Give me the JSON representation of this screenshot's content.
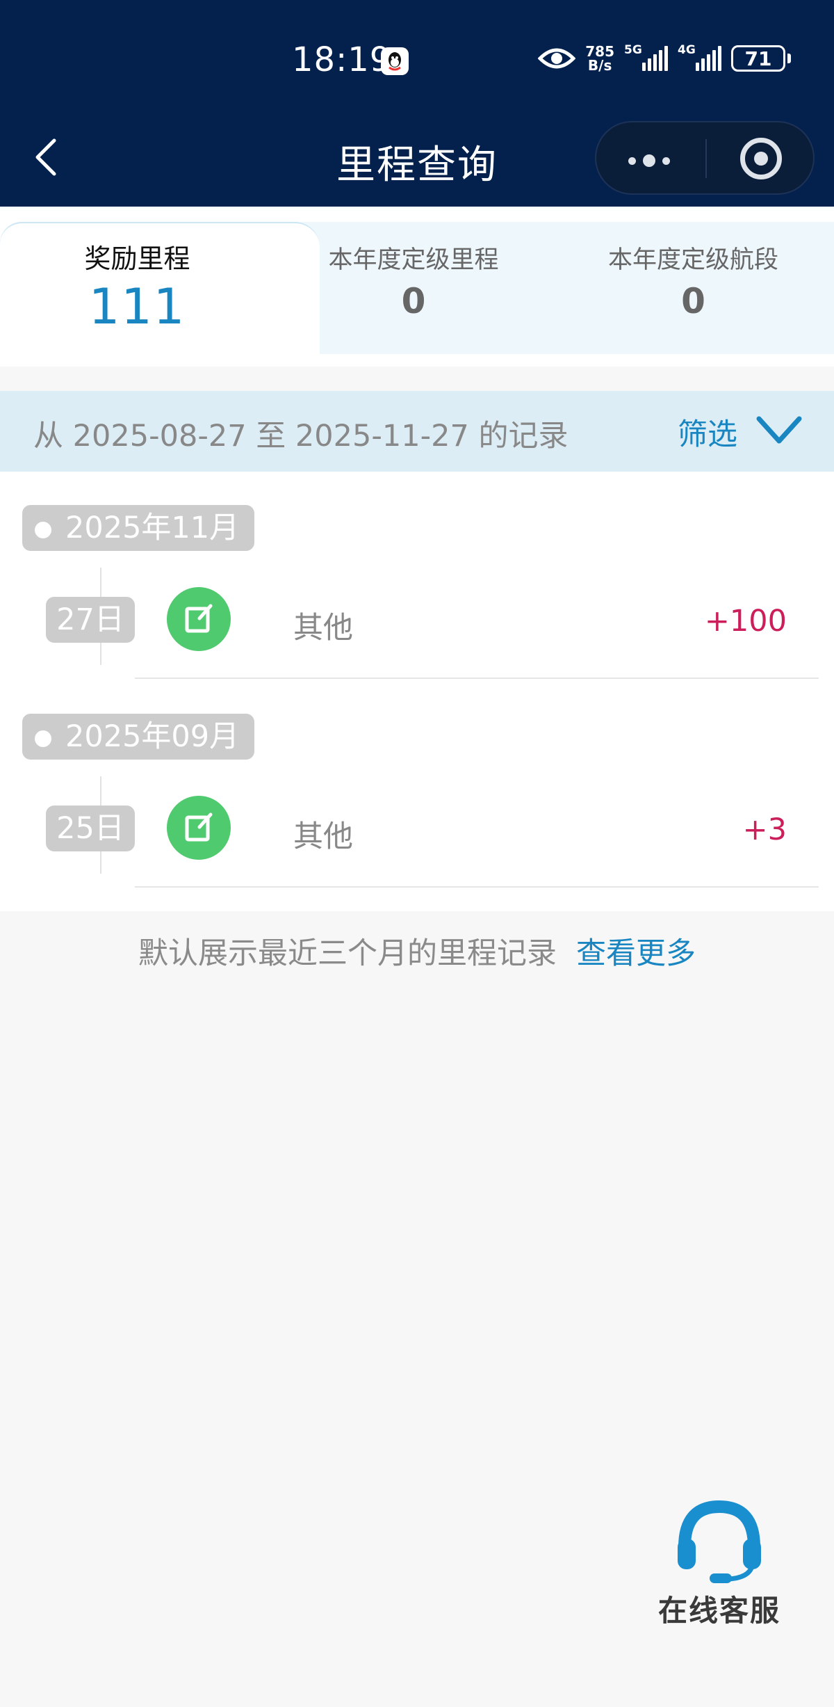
{
  "status_bar": {
    "time": "18:19",
    "net_speed_top": "785",
    "net_speed_bottom": "B/s",
    "sim1": "5G",
    "sim2": "4G",
    "battery": "71"
  },
  "nav": {
    "title": "里程查询"
  },
  "tabs": [
    {
      "label": "奖励里程",
      "value": "111",
      "active": true
    },
    {
      "label": "本年度定级里程",
      "value": "0",
      "active": false
    },
    {
      "label": "本年度定级航段",
      "value": "0",
      "active": false
    }
  ],
  "filter": {
    "range_text": "从 2025-08-27 至 2025-11-27 的记录",
    "button_label": "筛选"
  },
  "records": [
    {
      "month": "2025年11月",
      "day": "27日",
      "name": "其他",
      "amount": "+100"
    },
    {
      "month": "2025年09月",
      "day": "25日",
      "name": "其他",
      "amount": "+3"
    }
  ],
  "footer": {
    "note": "默认展示最近三个月的里程记录",
    "more_link": "查看更多"
  },
  "service": {
    "label": "在线客服"
  },
  "colors": {
    "header_bg": "#04214d",
    "accent": "#1a86c1",
    "amount": "#cc1e5a",
    "record_icon": "#4fca6e"
  }
}
